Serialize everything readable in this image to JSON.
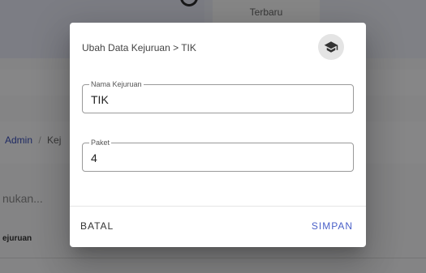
{
  "background": {
    "card_label": "Terbaru",
    "breadcrumb": {
      "first": "Admin",
      "separator": "/",
      "second": "Kej"
    },
    "search_placeholder": "nukan...",
    "column_header": "ejuruan"
  },
  "dialog": {
    "title": "Ubah Data Kejuruan > TIK",
    "avatar_icon": "graduation-cap-icon",
    "fields": [
      {
        "label": "Nama Kejuruan",
        "value": "TIK"
      },
      {
        "label": "Paket",
        "value": "4"
      }
    ],
    "cancel_label": "BATAL",
    "save_label": "SIMPAN"
  },
  "colors": {
    "accent": "#4a60c8",
    "overlay": "rgba(0,0,0,0.46)"
  }
}
